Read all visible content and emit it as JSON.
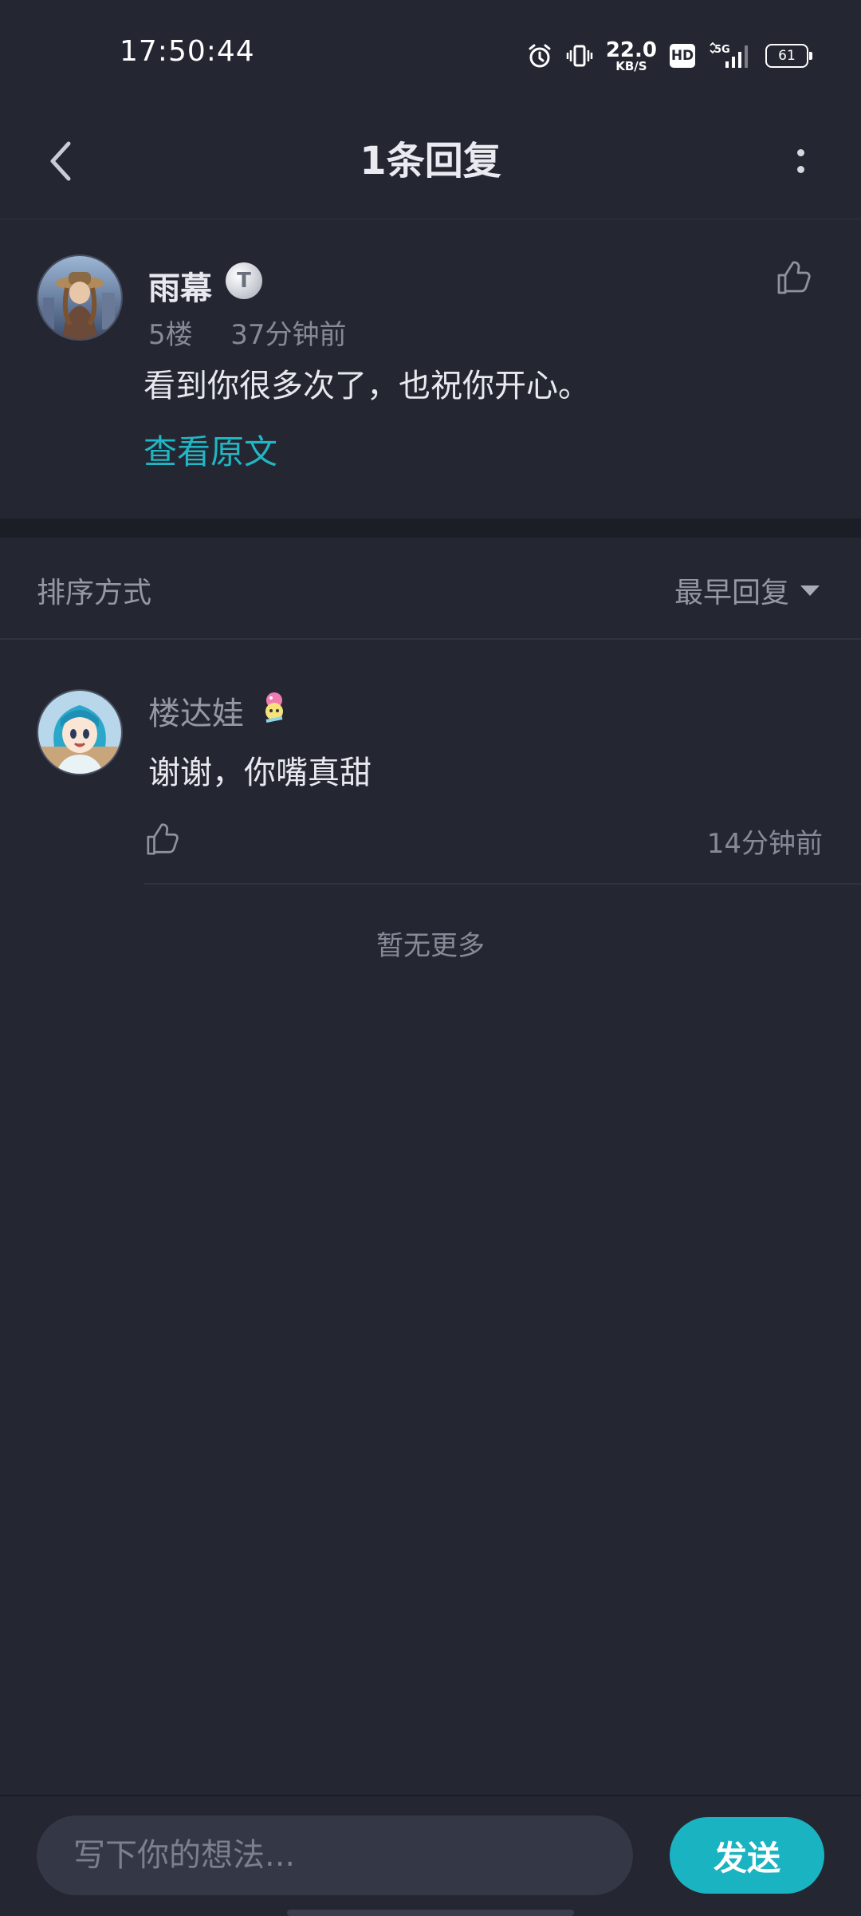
{
  "status_bar": {
    "time": "17:50:44",
    "net_speed_value": "22.0",
    "net_speed_unit": "KB/S",
    "hd": "HD",
    "network": "5G",
    "battery": "61",
    "icons": [
      "alarm-icon",
      "vibrate-icon",
      "hd-icon",
      "signal-icon",
      "battery-icon"
    ]
  },
  "header": {
    "title": "1条回复",
    "back_icon": "chevron-left-icon",
    "more_icon": "more-vertical-icon"
  },
  "main_comment": {
    "username": "雨幕",
    "floor": "5楼",
    "time": "37分钟前",
    "text": "看到你很多次了，也祝你开心。",
    "view_original": "查看原文"
  },
  "sort": {
    "label": "排序方式",
    "selected": "最早回复"
  },
  "replies": [
    {
      "username": "楼达娃",
      "text": "谢谢，你嘴真甜",
      "time": "14分钟前"
    }
  ],
  "footer": {
    "no_more": "暂无更多",
    "input_placeholder": "写下你的想法...",
    "send_label": "发送"
  },
  "colors": {
    "background": "#242732",
    "accent": "#1ab3c1",
    "link": "#20b7c4",
    "muted_text": "#868a96"
  }
}
